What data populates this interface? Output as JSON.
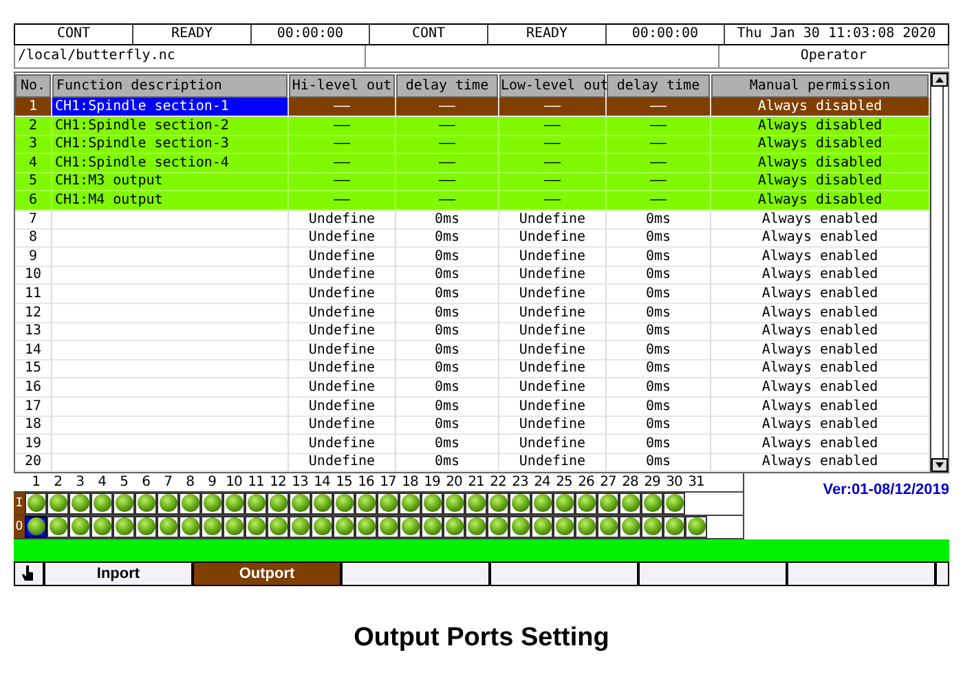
{
  "status_bar": [
    "CONT",
    "READY",
    "00:00:00",
    "CONT",
    "READY",
    "00:00:00",
    "Thu Jan 30 11:03:08 2020"
  ],
  "path_bar": {
    "file": "/local/butterfly.nc",
    "user": "Operator"
  },
  "table": {
    "columns": [
      "No.",
      "Function description",
      "Hi-level out",
      "delay time",
      "Low-level out",
      "delay time",
      "Manual permission"
    ],
    "rows": [
      {
        "cells": [
          "1",
          "CH1:Spindle section-1",
          "——",
          "——",
          "——",
          "——",
          "Always disabled"
        ],
        "selected": true,
        "highlighted": true
      },
      {
        "cells": [
          "2",
          "CH1:Spindle section-2",
          "——",
          "——",
          "——",
          "——",
          "Always disabled"
        ],
        "selected": false,
        "highlighted": true
      },
      {
        "cells": [
          "3",
          "CH1:Spindle section-3",
          "——",
          "——",
          "——",
          "——",
          "Always disabled"
        ],
        "selected": false,
        "highlighted": true
      },
      {
        "cells": [
          "4",
          "CH1:Spindle section-4",
          "——",
          "——",
          "——",
          "——",
          "Always disabled"
        ],
        "selected": false,
        "highlighted": true
      },
      {
        "cells": [
          "5",
          "CH1:M3 output",
          "——",
          "——",
          "——",
          "——",
          "Always disabled"
        ],
        "selected": false,
        "highlighted": true
      },
      {
        "cells": [
          "6",
          "CH1:M4 output",
          "——",
          "——",
          "——",
          "——",
          "Always disabled"
        ],
        "selected": false,
        "highlighted": true
      },
      {
        "cells": [
          "7",
          "",
          "Undefine",
          "0ms",
          "Undefine",
          "0ms",
          "Always enabled"
        ],
        "selected": false,
        "highlighted": false
      },
      {
        "cells": [
          "8",
          "",
          "Undefine",
          "0ms",
          "Undefine",
          "0ms",
          "Always enabled"
        ],
        "selected": false,
        "highlighted": false
      },
      {
        "cells": [
          "9",
          "",
          "Undefine",
          "0ms",
          "Undefine",
          "0ms",
          "Always enabled"
        ],
        "selected": false,
        "highlighted": false
      },
      {
        "cells": [
          "10",
          "",
          "Undefine",
          "0ms",
          "Undefine",
          "0ms",
          "Always enabled"
        ],
        "selected": false,
        "highlighted": false
      },
      {
        "cells": [
          "11",
          "",
          "Undefine",
          "0ms",
          "Undefine",
          "0ms",
          "Always enabled"
        ],
        "selected": false,
        "highlighted": false
      },
      {
        "cells": [
          "12",
          "",
          "Undefine",
          "0ms",
          "Undefine",
          "0ms",
          "Always enabled"
        ],
        "selected": false,
        "highlighted": false
      },
      {
        "cells": [
          "13",
          "",
          "Undefine",
          "0ms",
          "Undefine",
          "0ms",
          "Always enabled"
        ],
        "selected": false,
        "highlighted": false
      },
      {
        "cells": [
          "14",
          "",
          "Undefine",
          "0ms",
          "Undefine",
          "0ms",
          "Always enabled"
        ],
        "selected": false,
        "highlighted": false
      },
      {
        "cells": [
          "15",
          "",
          "Undefine",
          "0ms",
          "Undefine",
          "0ms",
          "Always enabled"
        ],
        "selected": false,
        "highlighted": false
      },
      {
        "cells": [
          "16",
          "",
          "Undefine",
          "0ms",
          "Undefine",
          "0ms",
          "Always enabled"
        ],
        "selected": false,
        "highlighted": false
      },
      {
        "cells": [
          "17",
          "",
          "Undefine",
          "0ms",
          "Undefine",
          "0ms",
          "Always enabled"
        ],
        "selected": false,
        "highlighted": false
      },
      {
        "cells": [
          "18",
          "",
          "Undefine",
          "0ms",
          "Undefine",
          "0ms",
          "Always enabled"
        ],
        "selected": false,
        "highlighted": false
      },
      {
        "cells": [
          "19",
          "",
          "Undefine",
          "0ms",
          "Undefine",
          "0ms",
          "Always enabled"
        ],
        "selected": false,
        "highlighted": false
      },
      {
        "cells": [
          "20",
          "",
          "Undefine",
          "0ms",
          "Undefine",
          "0ms",
          "Always enabled"
        ],
        "selected": false,
        "highlighted": false
      }
    ]
  },
  "io_panel": {
    "bit_numbers": [
      "1",
      "2",
      "3",
      "4",
      "5",
      "6",
      "7",
      "8",
      "9",
      "10",
      "11",
      "12",
      "13",
      "14",
      "15",
      "16",
      "17",
      "18",
      "19",
      "20",
      "21",
      "22",
      "23",
      "24",
      "25",
      "26",
      "27",
      "28",
      "29",
      "30",
      "31"
    ],
    "version": "Ver:01-08/12/2019",
    "input_label": "I",
    "output_label": "O",
    "inputs": [
      {
        "selected": false
      },
      {
        "selected": false
      },
      {
        "selected": false
      },
      {
        "selected": false
      },
      {
        "selected": false
      },
      {
        "selected": false
      },
      {
        "selected": false
      },
      {
        "selected": false
      },
      {
        "selected": false
      },
      {
        "selected": false
      },
      {
        "selected": false
      },
      {
        "selected": false
      },
      {
        "selected": false
      },
      {
        "selected": false
      },
      {
        "selected": false
      },
      {
        "selected": false
      },
      {
        "selected": false
      },
      {
        "selected": false
      },
      {
        "selected": false
      },
      {
        "selected": false
      },
      {
        "selected": false
      },
      {
        "selected": false
      },
      {
        "selected": false
      },
      {
        "selected": false
      },
      {
        "selected": false
      },
      {
        "selected": false
      },
      {
        "selected": false
      },
      {
        "selected": false
      },
      {
        "selected": false
      },
      {
        "selected": false
      }
    ],
    "outputs": [
      {
        "selected": true
      },
      {
        "selected": false
      },
      {
        "selected": false
      },
      {
        "selected": false
      },
      {
        "selected": false
      },
      {
        "selected": false
      },
      {
        "selected": false
      },
      {
        "selected": false
      },
      {
        "selected": false
      },
      {
        "selected": false
      },
      {
        "selected": false
      },
      {
        "selected": false
      },
      {
        "selected": false
      },
      {
        "selected": false
      },
      {
        "selected": false
      },
      {
        "selected": false
      },
      {
        "selected": false
      },
      {
        "selected": false
      },
      {
        "selected": false
      },
      {
        "selected": false
      },
      {
        "selected": false
      },
      {
        "selected": false
      },
      {
        "selected": false
      },
      {
        "selected": false
      },
      {
        "selected": false
      },
      {
        "selected": false
      },
      {
        "selected": false
      },
      {
        "selected": false
      },
      {
        "selected": false
      },
      {
        "selected": false
      },
      {
        "selected": false
      }
    ]
  },
  "tabs": [
    {
      "label": "Inport",
      "selected": false
    },
    {
      "label": "Outport",
      "selected": true
    }
  ],
  "caption": "Output Ports Setting"
}
